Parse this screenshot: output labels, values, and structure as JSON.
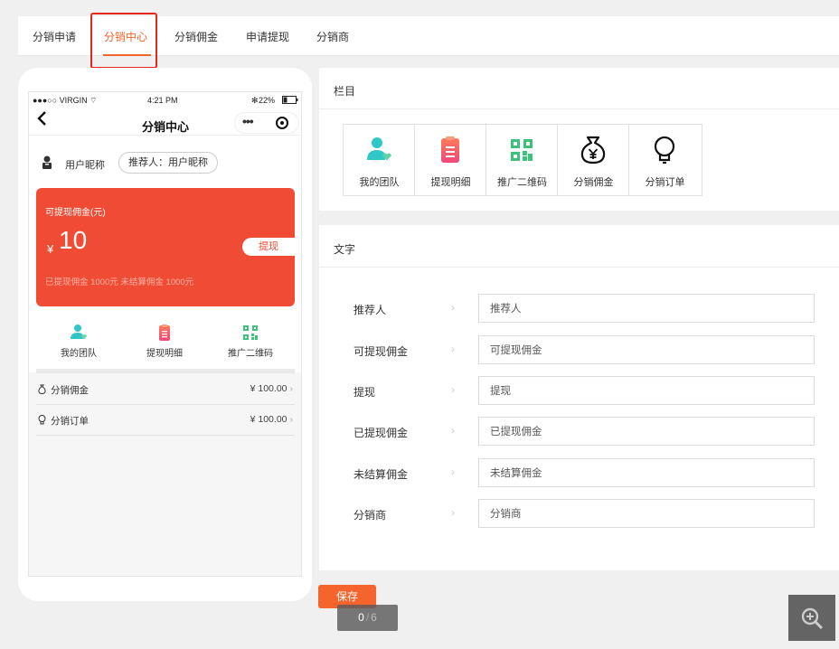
{
  "tabs": [
    {
      "label": "分销申请"
    },
    {
      "label": "分销中心"
    },
    {
      "label": "分销佣金"
    },
    {
      "label": "申请提现"
    },
    {
      "label": "分销商"
    }
  ],
  "phone": {
    "status_carrier": "●●●○○ VIRGIN",
    "status_time": "4:21 PM",
    "status_battery": "22%",
    "nav_title": "分销中心",
    "back_glyph": "‹",
    "user_name": "用户昵称",
    "referrer": "推荐人：用户昵称",
    "card": {
      "label": "可提现佣金(元)",
      "currency": "¥",
      "amount": "10",
      "withdraw_label": "提现",
      "sub_text": "已提现佣金 1000元   未结算佣金 1000元",
      "color": "#f04b34"
    },
    "quick_links": [
      {
        "label": "我的团队",
        "icon": "team-icon"
      },
      {
        "label": "提现明细",
        "icon": "clipboard-icon"
      },
      {
        "label": "推广二维码",
        "icon": "qrcode-icon"
      }
    ],
    "list": [
      {
        "label": "分销佣金",
        "value": "¥ 100.00",
        "icon": "money-bag-icon"
      },
      {
        "label": "分销订单",
        "value": "¥ 100.00",
        "icon": "bulb-icon"
      }
    ]
  },
  "columns_panel": {
    "title": "栏目",
    "items": [
      {
        "label": "我的团队",
        "icon": "team-icon"
      },
      {
        "label": "提现明细",
        "icon": "clipboard-icon"
      },
      {
        "label": "推广二维码",
        "icon": "qrcode-icon"
      },
      {
        "label": "分销佣金",
        "icon": "money-bag-icon"
      },
      {
        "label": "分销订单",
        "icon": "bulb-icon"
      }
    ]
  },
  "text_panel": {
    "title": "文字",
    "fields": [
      {
        "label": "推荐人",
        "value": "推荐人"
      },
      {
        "label": "可提现佣金",
        "value": "可提现佣金"
      },
      {
        "label": "提现",
        "value": "提现"
      },
      {
        "label": "已提现佣金",
        "value": "已提现佣金"
      },
      {
        "label": "未结算佣金",
        "value": "未结算佣金"
      },
      {
        "label": "分销商",
        "value": "分销商"
      }
    ]
  },
  "save_label": "保存",
  "pager": {
    "current": "0",
    "total": "6"
  },
  "accent": "#f5642d"
}
